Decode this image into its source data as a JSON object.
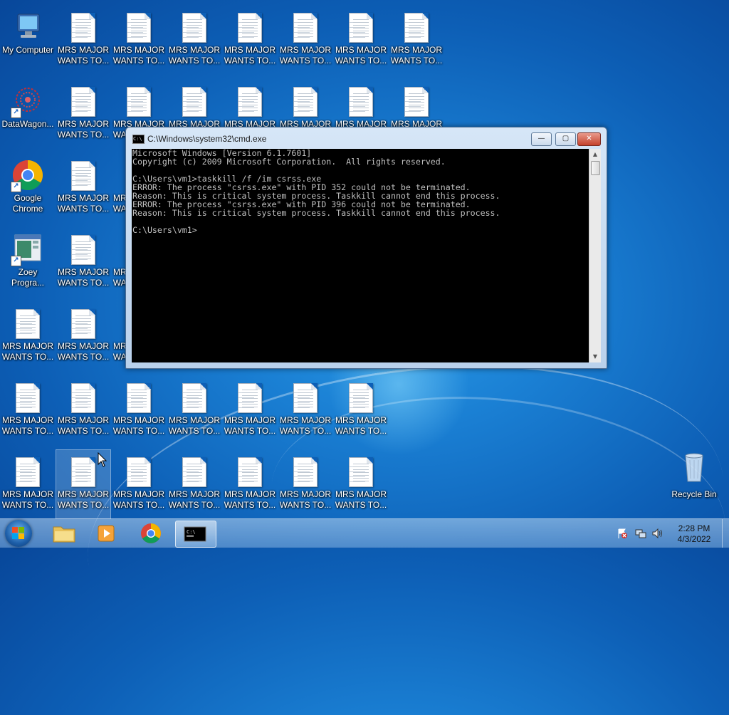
{
  "desktop": {
    "my_computer": "My Computer",
    "datawagon": "DataWagon...",
    "chrome_l1": "Google",
    "chrome_l2": "Chrome",
    "zoey_l1": "Zoey",
    "zoey_l2": "Progra...",
    "recycle_bin": "Recycle Bin",
    "doc_l1": "MRS MAJOR",
    "doc_l2": "WANTS TO..."
  },
  "cmd": {
    "title": "C:\\Windows\\system32\\cmd.exe",
    "lines": [
      "Microsoft Windows [Version 6.1.7601]",
      "Copyright (c) 2009 Microsoft Corporation.  All rights reserved.",
      "",
      "C:\\Users\\vm1>taskkill /f /im csrss.exe",
      "ERROR: The process \"csrss.exe\" with PID 352 could not be terminated.",
      "Reason: This is critical system process. Taskkill cannot end this process.",
      "ERROR: The process \"csrss.exe\" with PID 396 could not be terminated.",
      "Reason: This is critical system process. Taskkill cannot end this process.",
      "",
      "C:\\Users\\vm1>"
    ]
  },
  "taskbar": {
    "time": "2:28 PM",
    "date": "4/3/2022",
    "items": [
      "windows-explorer-icon",
      "media-player-icon",
      "chrome-icon",
      "cmd-icon"
    ]
  },
  "colors": {
    "console_bg": "#000000",
    "console_fg": "#c0c0c0",
    "close_btn": "#c4412c"
  }
}
